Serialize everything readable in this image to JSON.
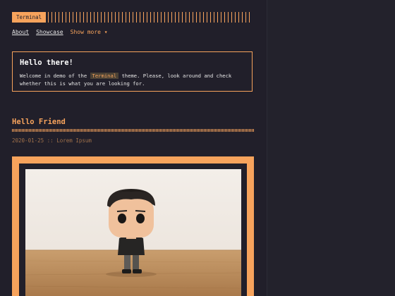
{
  "header": {
    "logo_text": "Terminal"
  },
  "nav": {
    "items": [
      "About",
      "Showcase"
    ],
    "more_label": "Show more ▾"
  },
  "intro": {
    "title": "Hello there!",
    "text_before": "Welcome in demo of the ",
    "code": "Terminal",
    "text_after": " theme. Please, look around and check whether this is what you are looking for."
  },
  "post": {
    "title": "Hello Friend",
    "date": "2020-01-25",
    "separator": "::",
    "author": "Lorem Ipsum"
  },
  "colors": {
    "accent": "#f7a35c",
    "background": "#211f2a"
  }
}
